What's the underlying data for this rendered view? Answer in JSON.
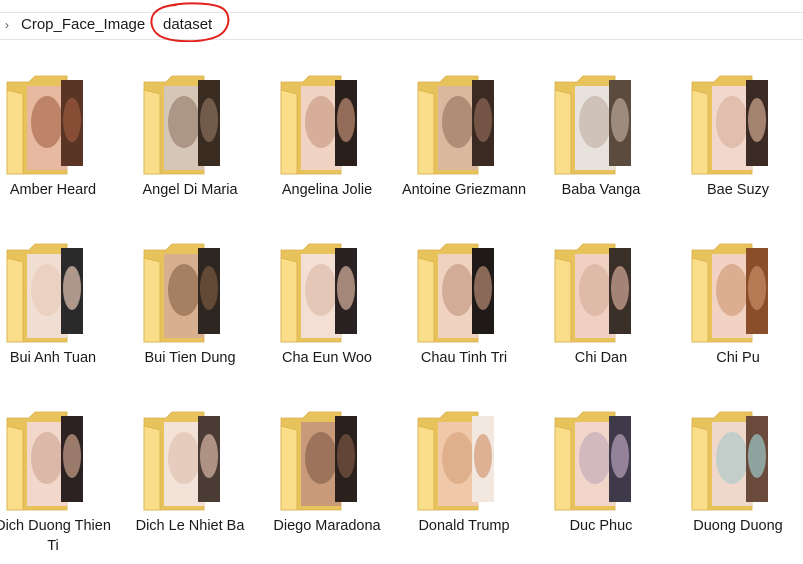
{
  "breadcrumb": {
    "chevron": "›",
    "root": "Crop_Face_Image",
    "current": "dataset",
    "annotation_color": "#e1221c"
  },
  "folder_colors": {
    "back": "#e8c25a",
    "front": "#f9dd88",
    "edge": "#d8b04a"
  },
  "folders": [
    {
      "name": "Amber Heard",
      "tones": [
        "#e8b9a1",
        "#9a5a3e",
        "#5a3424"
      ]
    },
    {
      "name": "Angel Di Maria",
      "tones": [
        "#d6c6b8",
        "#8a6f5b",
        "#3b2c22"
      ]
    },
    {
      "name": "Angelina Jolie",
      "tones": [
        "#f0d3c3",
        "#c28f76",
        "#2a1f1a"
      ]
    },
    {
      "name": "Antoine Griezmann",
      "tones": [
        "#dab79d",
        "#8f6a55",
        "#3a2a22"
      ]
    },
    {
      "name": "Baba Vanga",
      "tones": [
        "#e8e2dc",
        "#b9a89a",
        "#5b4a3e"
      ]
    },
    {
      "name": "Bae Suzy",
      "tones": [
        "#f2d8cc",
        "#d3aa93",
        "#3b2b24"
      ]
    },
    {
      "name": "Bui Anh Tuan",
      "tones": [
        "#f1ded2",
        "#e6c6b4",
        "#2a2a2a"
      ]
    },
    {
      "name": "Bui Tien Dung",
      "tones": [
        "#d9b08f",
        "#7a5a40",
        "#2e2620"
      ]
    },
    {
      "name": "Cha Eun Woo",
      "tones": [
        "#f3dfd3",
        "#d7b3a0",
        "#2a2222"
      ]
    },
    {
      "name": "Chau Tinh Tri",
      "tones": [
        "#f0d2c0",
        "#b98c74",
        "#1f1a18"
      ]
    },
    {
      "name": "Chi Dan",
      "tones": [
        "#f1d0c4",
        "#d1a894",
        "#3b2f2a"
      ]
    },
    {
      "name": "Chi Pu",
      "tones": [
        "#f2d3c3",
        "#c98e67",
        "#8a4f2a"
      ]
    },
    {
      "name": "Dich Duong Thien Ti",
      "tones": [
        "#f1d8cb",
        "#c99f8b",
        "#2b2221"
      ]
    },
    {
      "name": "Dich Le Nhiet Ba",
      "tones": [
        "#f3e2d7",
        "#d9b9a8",
        "#4a3b34"
      ]
    },
    {
      "name": "Diego Maradona",
      "tones": [
        "#c89a7a",
        "#7a5642",
        "#2a211c"
      ]
    },
    {
      "name": "Donald Trump",
      "tones": [
        "#efc9a9",
        "#d49a74",
        "#f2e8e0"
      ]
    },
    {
      "name": "Duc Phuc",
      "tones": [
        "#f0d5c8",
        "#b9a3b9",
        "#3f3a4a"
      ]
    },
    {
      "name": "Duong Duong",
      "tones": [
        "#efd7cc",
        "#9ec7c9",
        "#6a4a3a"
      ]
    }
  ]
}
